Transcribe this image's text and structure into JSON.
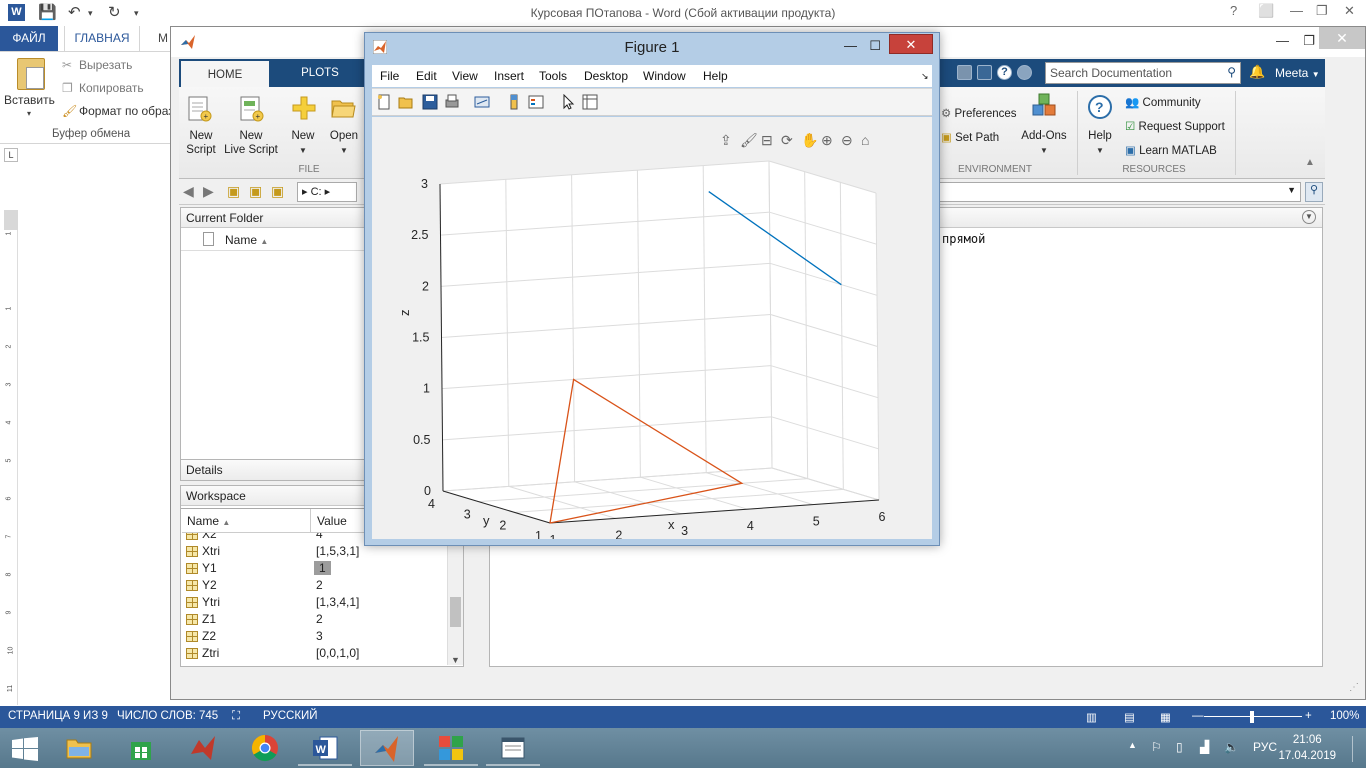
{
  "word": {
    "title": "Курсовая ПОтапова - Word (Сбой активации продукта)",
    "logo_letter": "W",
    "tabs": {
      "file": "ФАЙЛ",
      "home": "ГЛАВНАЯ",
      "more": "M"
    },
    "ribbon": {
      "paste": "Вставить",
      "cut": "Вырезать",
      "copy": "Копировать",
      "format": "Формат по образ",
      "group": "Буфер обмена"
    },
    "ruler_corner": "L",
    "status": {
      "page": "СТРАНИЦА 9 ИЗ 9",
      "words": "ЧИСЛО СЛОВ: 745",
      "lang": "РУССКИЙ",
      "zoom": "100%"
    },
    "window_controls": [
      "?",
      "⬜",
      "—",
      "❐",
      "✕"
    ]
  },
  "matlab": {
    "tabs": {
      "home": "HOME",
      "plots": "PLOTS"
    },
    "search_placeholder": "Search Documentation",
    "user": "Meeta",
    "ribbon": {
      "new_script_1": "New",
      "new_script_2": "Script",
      "new_live_1": "New",
      "new_live_2": "Live Script",
      "new": "New",
      "open": "Open",
      "file_group": "FILE",
      "preferences": "Preferences",
      "set_path": "Set Path",
      "addons": "Add-Ons",
      "help": "Help",
      "environment_group": "ENVIRONMENT",
      "community": "Community",
      "request_support": "Request Support",
      "learn_matlab": "Learn MATLAB",
      "resources_group": "RESOURCES"
    },
    "address_drive": "C:",
    "current_folder": {
      "title": "Current Folder",
      "name_col": "Name"
    },
    "details": "Details",
    "workspace": {
      "title": "Workspace",
      "name_col": "Name",
      "value_col": "Value",
      "rows": [
        {
          "name": "X2",
          "value": "4"
        },
        {
          "name": "Xtri",
          "value": "[1,5,3,1]"
        },
        {
          "name": "Y1",
          "value": "1"
        },
        {
          "name": "Y2",
          "value": "2"
        },
        {
          "name": "Ytri",
          "value": "[1,3,4,1]"
        },
        {
          "name": "Z1",
          "value": "2"
        },
        {
          "name": "Z2",
          "value": "3"
        },
        {
          "name": "Ztri",
          "value": "[0,0,1,0]"
        }
      ]
    },
    "command_text": "прямой"
  },
  "figure": {
    "title": "Figure 1",
    "menu": [
      "File",
      "Edit",
      "View",
      "Insert",
      "Tools",
      "Desktop",
      "Window",
      "Help"
    ]
  },
  "chart_data": {
    "type": "line",
    "projection": "3d",
    "xlabel": "x",
    "ylabel": "y",
    "zlabel": "z",
    "x_ticks": [
      "1",
      "2",
      "3",
      "4",
      "5",
      "6"
    ],
    "y_ticks": [
      "1",
      "2",
      "3",
      "4"
    ],
    "z_ticks": [
      "0",
      "0.5",
      "1",
      "1.5",
      "2",
      "2.5",
      "3"
    ],
    "xlim": [
      1,
      6
    ],
    "ylim": [
      1,
      4
    ],
    "zlim": [
      0,
      3
    ],
    "grid": true,
    "series": [
      {
        "color": "#0072bd",
        "x": [
          4,
          6
        ],
        "y": [
          2,
          2
        ],
        "z": [
          3,
          2
        ]
      },
      {
        "color": "#d95319",
        "x": [
          1,
          5,
          3,
          1
        ],
        "y": [
          1,
          3,
          4,
          1
        ],
        "z": [
          0,
          0,
          1,
          0
        ]
      }
    ]
  },
  "taskbar": {
    "lang": "РУС",
    "time": "21:06",
    "date": "17.04.2019"
  }
}
